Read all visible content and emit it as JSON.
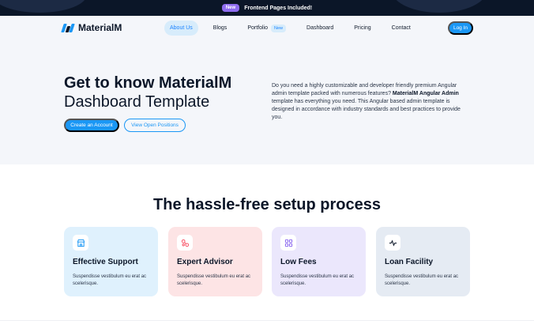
{
  "announcement": {
    "badge": "New",
    "message": "Frontend Pages Included!"
  },
  "brand": {
    "name": "MaterialM",
    "colors": [
      "#1a97f5",
      "#0b1628"
    ]
  },
  "nav": {
    "items": [
      {
        "label": "About Us",
        "active": true
      },
      {
        "label": "Blogs"
      },
      {
        "label": "Portfolio",
        "badge": "New"
      },
      {
        "label": "Dashboard"
      },
      {
        "label": "Pricing"
      },
      {
        "label": "Contact"
      }
    ],
    "login": "Log In"
  },
  "hero": {
    "title_line1": "Get to know MaterialM",
    "title_line2": "Dashboard Template",
    "primary_cta": "Create an Account",
    "secondary_cta": "View Open Positions",
    "desc_before": "Do you need a highly customizable and developer friendly premium Angular admin template packed with numerous features? ",
    "desc_bold": "MaterialM Angular Admin",
    "desc_after": " template has everything you need. This Angular based admin template is designed in accordance with industry standards and best practices to provide you."
  },
  "section": {
    "title": "The hassle-free setup process",
    "cards": [
      {
        "title": "Effective Support",
        "text": "Suspendisse vestibulum eu erat ac scelerisque.",
        "icon": "store-icon",
        "bg": "#dff1fd",
        "icon_color": "#1a97f5"
      },
      {
        "title": "Expert Advisor",
        "text": "Suspendisse vestibulum eu erat ac scelerisque.",
        "icon": "nodes-icon",
        "bg": "#fde4e5",
        "icon_color": "#f8576a"
      },
      {
        "title": "Low Fees",
        "text": "Suspendisse vestibulum eu erat ac scelerisque.",
        "icon": "grid-icon",
        "bg": "#ebe7fc",
        "icon_color": "#8e6cf0"
      },
      {
        "title": "Loan Facility",
        "text": "Suspendisse vestibulum eu erat ac scelerisque.",
        "icon": "pulse-icon",
        "bg": "#e5ebf3",
        "icon_color": "#0b1628"
      }
    ]
  }
}
